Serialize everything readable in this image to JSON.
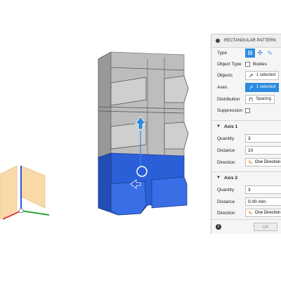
{
  "panel": {
    "title": "RECTANGULAR PATTERN",
    "type_label": "Type",
    "object_type_label": "Object Type",
    "object_type_value": "Bodies",
    "objects_label": "Objects",
    "objects_value": "1 selected",
    "axes_label": "Axes",
    "axes_value": "1 selected",
    "distribution_label": "Distribution",
    "distribution_value": "Spacing",
    "suppression_label": "Suppression",
    "axis1": {
      "header": "Axis 1",
      "quantity_label": "Quantity",
      "quantity_value": "3",
      "distance_label": "Distance",
      "distance_value": "10",
      "direction_label": "Direction",
      "direction_value": "One Direction"
    },
    "axis2": {
      "header": "Axis 2",
      "quantity_label": "Quantity",
      "quantity_value": "3",
      "distance_label": "Distance",
      "distance_value": "0.00 mm",
      "direction_label": "Direction",
      "direction_value": "One Direction"
    },
    "ok_label": "OK"
  },
  "colors": {
    "accent": "#2b8be0",
    "body_gray": "#a0a0a0",
    "body_blue": "#2a5fd8",
    "triad_fill": "#f9d9a8"
  },
  "icons": {
    "type_rectangular": "rectangular-pattern-icon",
    "type_circular": "circular-pattern-icon",
    "type_path": "path-pattern-icon",
    "cursor": "cursor-arrow-icon",
    "direction": "pencil-direction-icon",
    "info": "info-icon"
  }
}
